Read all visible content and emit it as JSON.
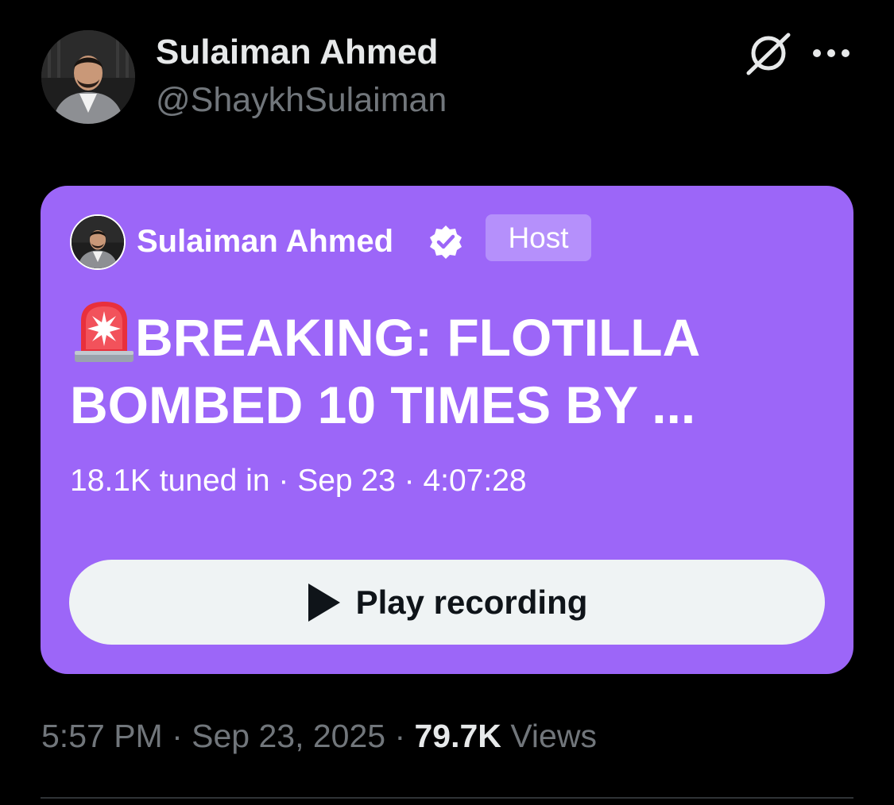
{
  "author": {
    "name": "Sulaiman Ahmed",
    "handle": "@ShaykhSulaiman"
  },
  "space": {
    "host_name": "Sulaiman Ahmed",
    "host_badge": "Host",
    "title_icon": "police-siren-emoji",
    "title": "BREAKING: FLOTILLA BOMBED 10 TIMES BY ...",
    "meta": "18.1K tuned in · Sep 23 · 4:07:28",
    "play_label": "Play recording",
    "background_color": "#9c66f8"
  },
  "tweet": {
    "timestamp": "5:57 PM · Sep 23, 2025 · ",
    "views_count": "79.7K",
    "views_label": " Views"
  },
  "icons": {
    "grok": "grok-icon",
    "more": "more-options-icon",
    "verified": "verified-badge-icon",
    "play": "play-icon"
  },
  "colors": {
    "background": "#000000",
    "primary_text": "#e7e9ea",
    "secondary_text": "#71767b",
    "button_bg": "#eff3f4"
  }
}
